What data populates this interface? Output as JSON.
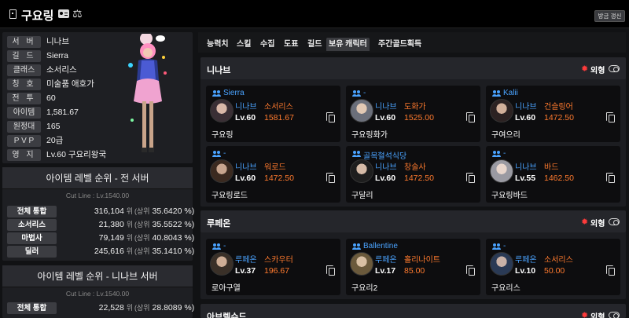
{
  "header": {
    "character_name": "구요링",
    "refresh_label": "방금 갱신"
  },
  "profile": {
    "rows": [
      {
        "label": "서 버",
        "value": "니나브"
      },
      {
        "label": "길 드",
        "value": "Sierra"
      },
      {
        "label": "클래스",
        "value": "소서리스"
      },
      {
        "label": "칭 호",
        "value": "미술품 애호가"
      },
      {
        "label": "전 투",
        "value": "60"
      },
      {
        "label": "아이템",
        "value": "1,581.67"
      },
      {
        "label": "원정대",
        "value": "165"
      },
      {
        "label": "P V P",
        "value": "20급"
      },
      {
        "label": "영 지",
        "value": "Lv.60 구요리왕국"
      }
    ]
  },
  "rank_all": {
    "title": "아이템 레벨 순위 - 전 서버",
    "cutline": "Cut Line : Lv.1540.00",
    "rows": [
      {
        "label": "전체 통합",
        "rank": "316,104",
        "unit": "위",
        "pct_prefix": "(상위",
        "pct": "35.6420 %)"
      },
      {
        "label": "소서리스",
        "rank": "21,380",
        "unit": "위",
        "pct_prefix": "(상위",
        "pct": "35.5522 %)"
      },
      {
        "label": "마법사",
        "rank": "79,149",
        "unit": "위",
        "pct_prefix": "(상위",
        "pct": "40.8043 %)"
      },
      {
        "label": "딜러",
        "rank": "245,616",
        "unit": "위",
        "pct_prefix": "(상위",
        "pct": "35.1410 %)"
      }
    ]
  },
  "rank_server": {
    "title": "아이템 레벨 순위 - 니나브 서버",
    "cutline": "Cut Line : Lv.1540.00",
    "rows": [
      {
        "label": "전체 통합",
        "rank": "22,528",
        "unit": "위",
        "pct_prefix": "(상위",
        "pct": "28.8089 %)"
      }
    ]
  },
  "tabs": [
    "능력치",
    "스킬",
    "수집",
    "도표",
    "길드",
    "보유 캐릭터",
    "주간골드획득"
  ],
  "active_tab": "보유 캐릭터",
  "outfit_label": "외형",
  "sections": [
    {
      "server": "니나브",
      "characters": [
        {
          "guild": "Sierra",
          "server": "니나브",
          "class": "소서리스",
          "level": "Lv.60",
          "item_level": "1581.67",
          "name": "구요링"
        },
        {
          "guild": "-",
          "server": "니나브",
          "class": "도화가",
          "level": "Lv.60",
          "item_level": "1525.00",
          "name": "구요링화가"
        },
        {
          "guild": "Kalii",
          "server": "니나브",
          "class": "건슬링어",
          "level": "Lv.60",
          "item_level": "1472.50",
          "name": "구여으리"
        },
        {
          "guild": "-",
          "server": "니나브",
          "class": "워로드",
          "level": "Lv.60",
          "item_level": "1472.50",
          "name": "구요링로드"
        },
        {
          "guild": "골목혈석식당",
          "server": "니나브",
          "class": "창술사",
          "level": "Lv.60",
          "item_level": "1472.50",
          "name": "구달리"
        },
        {
          "guild": "-",
          "server": "니나브",
          "class": "바드",
          "level": "Lv.55",
          "item_level": "1462.50",
          "name": "구요링바드"
        }
      ]
    },
    {
      "server": "루페온",
      "characters": [
        {
          "guild": "-",
          "server": "루페온",
          "class": "스카우터",
          "level": "Lv.37",
          "item_level": "196.67",
          "name": "로아구열"
        },
        {
          "guild": "Ballentine",
          "server": "루페온",
          "class": "홀리나이트",
          "level": "Lv.17",
          "item_level": "85.00",
          "name": "구요리2"
        },
        {
          "guild": "-",
          "server": "루페온",
          "class": "소서리스",
          "level": "Lv.10",
          "item_level": "50.00",
          "name": "구요리스"
        }
      ]
    },
    {
      "server": "아브렐슈드",
      "characters": []
    }
  ]
}
